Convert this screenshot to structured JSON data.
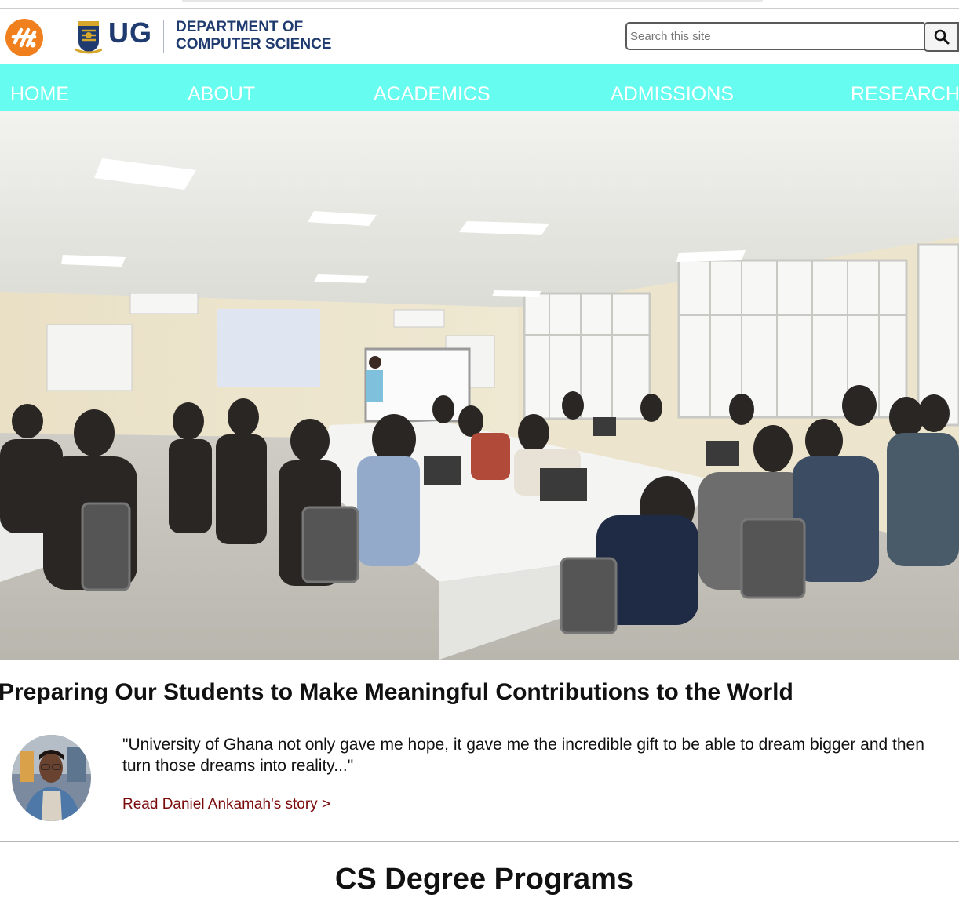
{
  "header": {
    "ug_label": "UG",
    "department_line1": "DEPARTMENT OF",
    "department_line2": "COMPUTER SCIENCE",
    "search": {
      "placeholder": "Search this site",
      "value": ""
    }
  },
  "nav": {
    "items": [
      {
        "label": "HOME"
      },
      {
        "label": "ABOUT"
      },
      {
        "label": "ACADEMICS"
      },
      {
        "label": "ADMISSIONS"
      },
      {
        "label": "RESEARCH"
      }
    ]
  },
  "hero": {
    "image": "classroom-photo"
  },
  "feature": {
    "headline": "Preparing Our Students to Make Meaningful Contributions to the World",
    "quote": "\"University of Ghana not only gave me hope, it gave me the incredible gift to be able to dream bigger and then turn those dreams into reality...\"",
    "link_label": "Read Daniel Ankamah's story >"
  },
  "programs": {
    "title": "CS Degree Programs"
  },
  "colors": {
    "nav_bg": "#66fcef",
    "brand_blue": "#1f3b6f",
    "logo_orange": "#f0801e",
    "link": "#7a0a0a"
  }
}
